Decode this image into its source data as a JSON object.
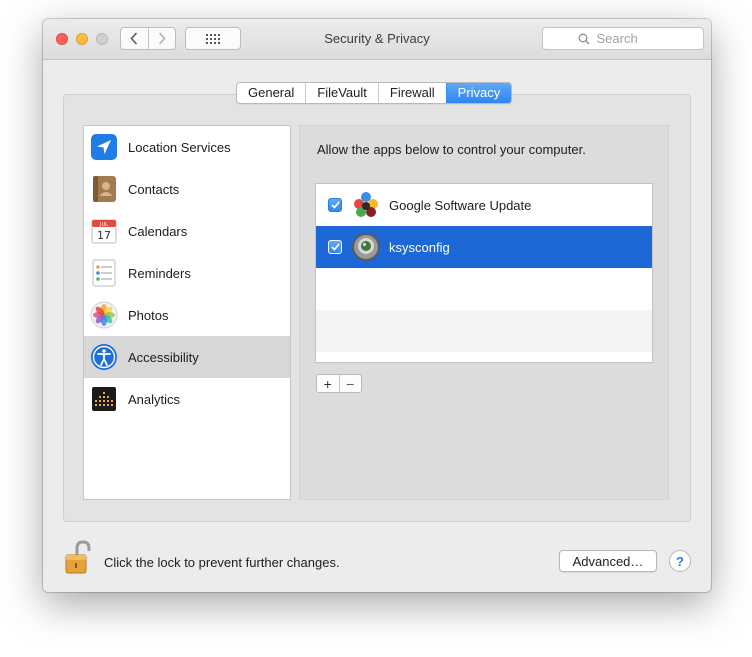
{
  "window": {
    "title": "Security & Privacy",
    "search_placeholder": "Search"
  },
  "tabs": [
    {
      "label": "General",
      "selected": false
    },
    {
      "label": "FileVault",
      "selected": false
    },
    {
      "label": "Firewall",
      "selected": false
    },
    {
      "label": "Privacy",
      "selected": true
    }
  ],
  "sidebar": {
    "items": [
      {
        "label": "Location Services",
        "icon": "location-icon",
        "selected": false
      },
      {
        "label": "Contacts",
        "icon": "contacts-icon",
        "selected": false
      },
      {
        "label": "Calendars",
        "icon": "calendar-icon",
        "selected": false,
        "icon_month": "JUL",
        "icon_day": "17"
      },
      {
        "label": "Reminders",
        "icon": "reminders-icon",
        "selected": false
      },
      {
        "label": "Photos",
        "icon": "photos-icon",
        "selected": false
      },
      {
        "label": "Accessibility",
        "icon": "accessibility-icon",
        "selected": true
      },
      {
        "label": "Analytics",
        "icon": "analytics-icon",
        "selected": false
      }
    ]
  },
  "content": {
    "description": "Allow the apps below to control your computer.",
    "apps": [
      {
        "name": "Google Software Update",
        "checked": true,
        "selected": false,
        "icon": "google-software-update-icon"
      },
      {
        "name": "ksysconfig",
        "checked": true,
        "selected": true,
        "icon": "ksysconfig-icon"
      }
    ],
    "add_label": "+",
    "remove_label": "−"
  },
  "footer": {
    "lock_text": "Click the lock to prevent further changes.",
    "advanced_label": "Advanced…",
    "help_label": "?"
  },
  "colors": {
    "accent": "#2d86ef",
    "selection": "#1d68d6"
  }
}
